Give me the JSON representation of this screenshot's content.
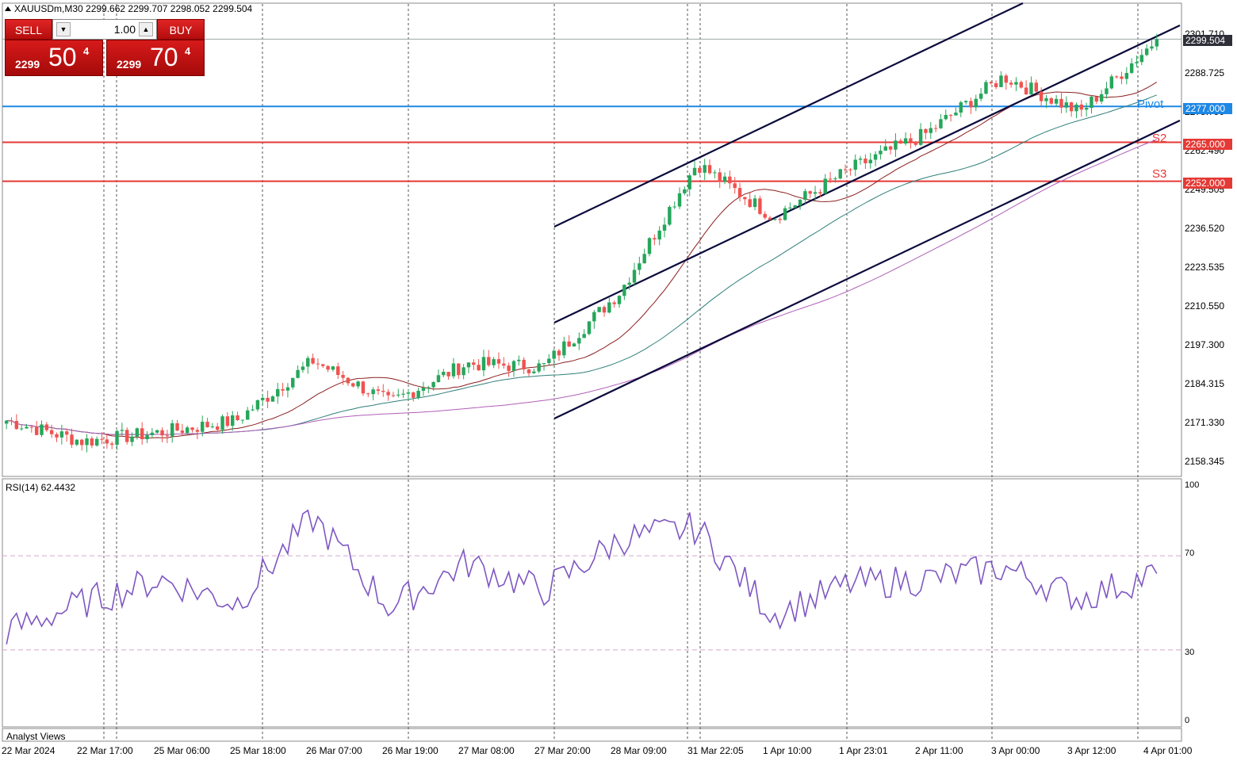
{
  "window": {
    "symbol_header": "XAUUSDm,M30  2299.662 2299.707 2298.052 2299.504"
  },
  "trade_panel": {
    "sell_label": "SELL",
    "buy_label": "BUY",
    "lot_value": "1.00",
    "sell_price": {
      "small": "2299",
      "big": "50",
      "sup": "4"
    },
    "buy_price": {
      "small": "2299",
      "big": "70",
      "sup": "4"
    }
  },
  "price_axis": {
    "ticks": [
      "2301.710",
      "2288.725",
      "2275.790",
      "2262.490",
      "2249.505",
      "2236.520",
      "2223.535",
      "2210.550",
      "2197.300",
      "2184.315",
      "2171.330",
      "2158.345"
    ],
    "current_price": "2299.504",
    "pivot_price": "2277.000",
    "s2_price": "2265.000",
    "s3_price": "2252.000"
  },
  "levels": {
    "pivot_label": "Pivot",
    "s2_label": "S2",
    "s3_label": "S3"
  },
  "rsi": {
    "label": "RSI(14) 62.4432",
    "ticks": [
      "100",
      "70",
      "30",
      "0"
    ]
  },
  "bottom_panel_label": "Analyst Views",
  "time_axis": [
    "22 Mar 2024",
    "22 Mar 17:00",
    "25 Mar 06:00",
    "25 Mar 18:00",
    "26 Mar 07:00",
    "26 Mar 19:00",
    "27 Mar 08:00",
    "27 Mar 20:00",
    "28 Mar 09:00",
    "31 Mar 22:05",
    "1 Apr 10:00",
    "1 Apr 23:01",
    "2 Apr 11:00",
    "3 Apr 00:00",
    "3 Apr 12:00",
    "4 Apr 01:00"
  ],
  "colors": {
    "up_candle": "#26a65b",
    "down_candle": "#ef5350",
    "pivot_line": "#1e88e5",
    "support_line": "#e53935",
    "rsi_line": "#7e57c2",
    "channel_line": "#0a0a3c"
  },
  "chart_data": {
    "type": "candlestick",
    "symbol": "XAUUSDm",
    "timeframe": "M30",
    "close_path": [
      [
        "22 Mar 2024",
        2172
      ],
      [
        "22 Mar 17:00",
        2165
      ],
      [
        "25 Mar 06:00",
        2168
      ],
      [
        "25 Mar 18:00",
        2172
      ],
      [
        "26 Mar 07:00",
        2192
      ],
      [
        "26 Mar 19:00",
        2178
      ],
      [
        "27 Mar 08:00",
        2191
      ],
      [
        "27 Mar 20:00",
        2190
      ],
      [
        "28 Mar 09:00",
        2215
      ],
      [
        "31 Mar 22:05",
        2258
      ],
      [
        "1 Apr 10:00",
        2240
      ],
      [
        "1 Apr 23:01",
        2256
      ],
      [
        "2 Apr 11:00",
        2268
      ],
      [
        "3 Apr 00:00",
        2287
      ],
      [
        "3 Apr 12:00",
        2275
      ],
      [
        "4 Apr 01:00",
        2299.504
      ]
    ],
    "levels": {
      "pivot": 2277.0,
      "s2": 2265.0,
      "s3": 2252.0
    },
    "ylim": [
      2153,
      2309
    ],
    "rsi_ylim": [
      0,
      100
    ],
    "rsi_levels": [
      70,
      30
    ],
    "rsi_path": [
      [
        "22 Mar 2024",
        38
      ],
      [
        "22 Mar 17:00",
        50
      ],
      [
        "25 Mar 06:00",
        60
      ],
      [
        "25 Mar 18:00",
        50
      ],
      [
        "26 Mar 07:00",
        86
      ],
      [
        "26 Mar 19:00",
        48
      ],
      [
        "27 Mar 08:00",
        67
      ],
      [
        "27 Mar 20:00",
        55
      ],
      [
        "28 Mar 09:00",
        77
      ],
      [
        "31 Mar 22:05",
        82
      ],
      [
        "1 Apr 10:00",
        45
      ],
      [
        "1 Apr 23:01",
        58
      ],
      [
        "2 Apr 11:00",
        60
      ],
      [
        "3 Apr 00:00",
        65
      ],
      [
        "3 Apr 12:00",
        52
      ],
      [
        "4 Apr 01:00",
        62.4432
      ]
    ]
  }
}
